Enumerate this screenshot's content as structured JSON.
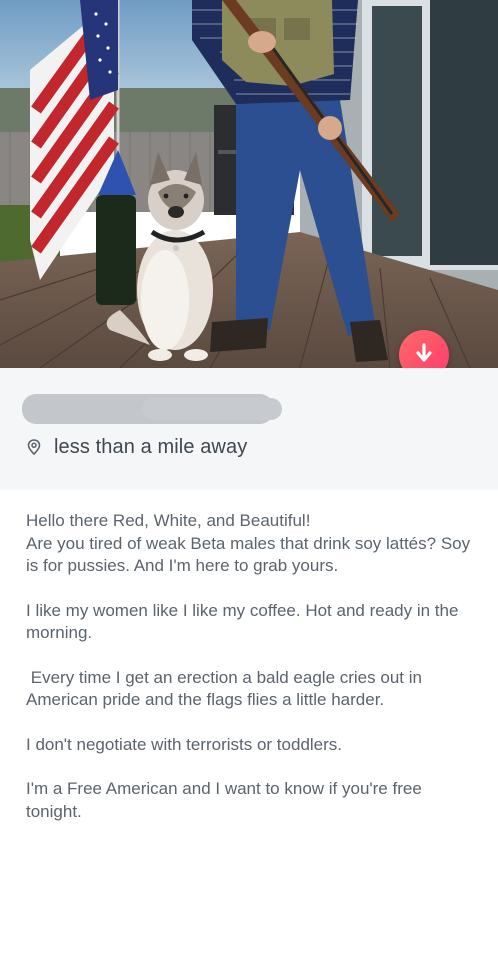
{
  "profile": {
    "distance_text": "less than a mile away",
    "distance_icon": "location-pin-icon",
    "name_redacted": true
  },
  "actions": {
    "collapse_icon": "arrow-down-icon",
    "accent_color": "#fd4a6b"
  },
  "photo": {
    "description_icon": "profile-photo"
  },
  "bio": {
    "paragraphs": [
      "Hello there Red, White, and Beautiful!\nAre you tired of weak Beta males that drink soy lattés? Soy is for pussies. And I'm here to grab yours.",
      "I like my women like I like my coffee. Hot and ready in the morning.",
      " Every time I get an erection a bald eagle cries out in American pride and the flags flies a little harder.",
      "I don't negotiate with terrorists or toddlers.",
      "I'm a Free American and I want to know if you're free tonight."
    ]
  }
}
